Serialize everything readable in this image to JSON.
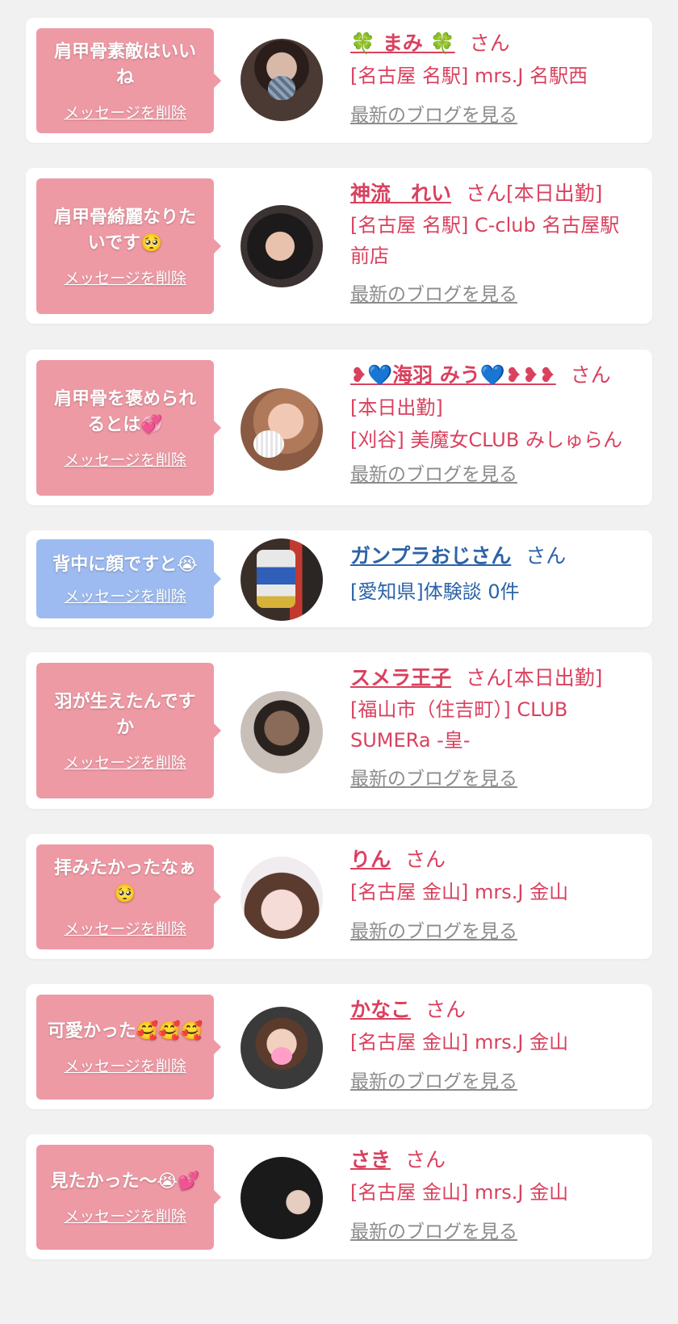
{
  "colors": {
    "bubble_pink": "#ee9aa5",
    "bubble_blue": "#9dbbf0",
    "text_pink": "#d9415e",
    "text_blue": "#2c63a8",
    "link_gray": "#8c8c8c"
  },
  "common": {
    "delete_label": "メッセージを削除",
    "blog_label": "最新のブログを見る",
    "san": "さん"
  },
  "cards": [
    {
      "message": "肩甲骨素敵はいいね",
      "name": "🍀 まみ 🍀",
      "suffix": "",
      "shop_lines": [
        "[名古屋 名駅] mrs.J 名駅西"
      ]
    },
    {
      "message": "肩甲骨綺麗なりたいです🥺",
      "name": "神流　れい",
      "suffix": "[本日出勤]",
      "shop_lines": [
        "[名古屋 名駅] C-club 名古屋駅前店"
      ]
    },
    {
      "message": "肩甲骨を褒められるとは💞",
      "name": "❥💙海羽 みう💙❥❥❥",
      "suffix": "",
      "shop_lines": [
        "[本日出勤]",
        "[刈谷] 美魔女CLUB みしゅらん"
      ]
    },
    {
      "message": "背中に顔ですと😭",
      "name": "ガンプラおじさん",
      "suffix": "",
      "shop_lines": [
        "[愛知県]体験談 0件"
      ]
    },
    {
      "message": "羽が生えたんですか",
      "name": "スメラ王子",
      "suffix": "[本日出勤]",
      "shop_lines": [
        "[福山市（住吉町）] CLUB SUMERa -皇-"
      ]
    },
    {
      "message": "拝みたかったなぁ🥺",
      "name": "りん",
      "suffix": "",
      "shop_lines": [
        "[名古屋 金山] mrs.J 金山"
      ]
    },
    {
      "message": "可愛かった🥰🥰🥰",
      "name": "かなこ",
      "suffix": "",
      "shop_lines": [
        "[名古屋 金山] mrs.J 金山"
      ]
    },
    {
      "message": "見たかった〜😭💕",
      "name": "さき",
      "suffix": "",
      "shop_lines": [
        "[名古屋 金山] mrs.J 金山"
      ]
    }
  ]
}
